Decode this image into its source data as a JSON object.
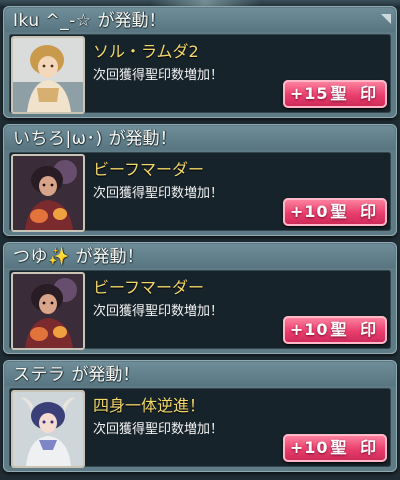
{
  "notifications": [
    {
      "player_name": "Iku ^_-☆",
      "trigger_text": "が発動！",
      "skill_name": "ソル・ラムダ2",
      "description": "次回獲得聖印数増加！",
      "bonus_value": "+15",
      "bonus_unit": "聖 印",
      "portrait": "hero-blonde-icon"
    },
    {
      "player_name": "いちろ|ω･)",
      "trigger_text": "が発動！",
      "skill_name": "ビーフマーダー",
      "description": "次回獲得聖印数増加！",
      "bonus_value": "+10",
      "bonus_unit": "聖 印",
      "portrait": "hero-dark-icon"
    },
    {
      "player_name": "つゆ✨",
      "trigger_text": "が発動！",
      "skill_name": "ビーフマーダー",
      "description": "次回獲得聖印数増加！",
      "bonus_value": "+10",
      "bonus_unit": "聖 印",
      "portrait": "hero-dark-icon"
    },
    {
      "player_name": "ステラ",
      "trigger_text": "が発動！",
      "skill_name": "四身一体逆進！",
      "description": "次回獲得聖印数増加！",
      "bonus_value": "+10",
      "bonus_unit": "聖 印",
      "portrait": "hero-horned-icon"
    }
  ],
  "colors": {
    "skill_name": "#f2d76a",
    "badge": "#ea3e6d",
    "card_frame": "#5e7b86",
    "panel": "#17232a"
  }
}
